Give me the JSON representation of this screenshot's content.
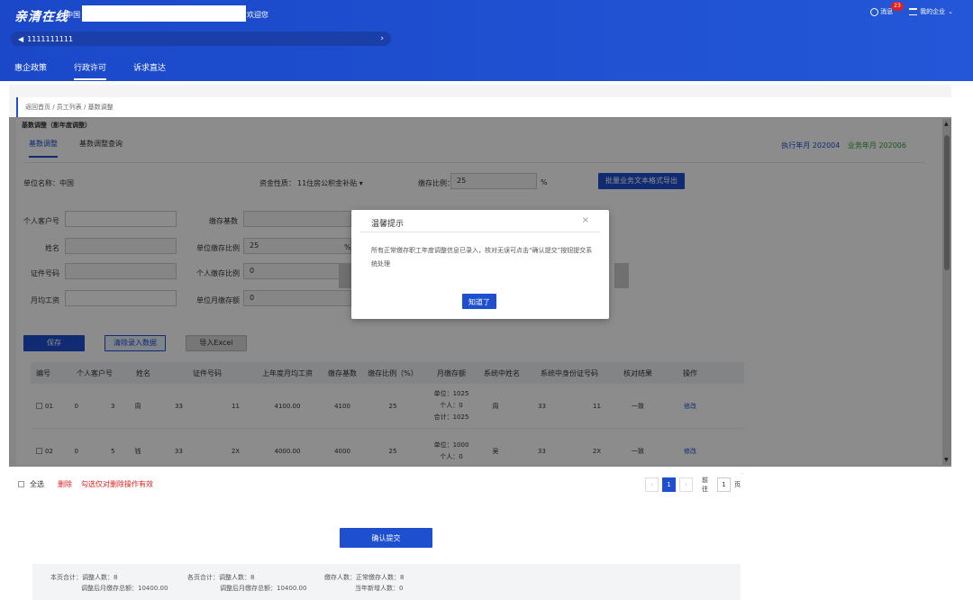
{
  "header": {
    "logo": "亲清在线",
    "region": "· 中国",
    "welcome": "欢迎您",
    "messages_label": "消息",
    "messages_count": "23",
    "enterprise_label": "我的企业",
    "notice_text": "1111111111",
    "nav": [
      {
        "label": "惠企政策"
      },
      {
        "label": "行政许可"
      },
      {
        "label": "诉求直达"
      }
    ]
  },
  "breadcrumb": "返回首页 / 员工列表 / 基数调整",
  "panel": {
    "title": "基数调整（影年度调整）",
    "tabs": [
      {
        "label": "基数调整"
      },
      {
        "label": "基数调整查询"
      }
    ],
    "exec_year": "执行年月 202004",
    "biz_year": "业务年月 202006"
  },
  "form": {
    "unit_name_label": "单位名称：中国",
    "fund_type_label": "资金性质：",
    "fund_type_value": "11住房公积金补贴",
    "ratio_label": "缴存比例：",
    "ratio_value": "25",
    "ratio_unit": "%",
    "export_button": "批量业务文本格式导出",
    "personal_account_label": "个人客户号",
    "deposit_base_label": "缴存基数",
    "name_label": "姓名",
    "unit_ratio_label": "单位缴存比例",
    "unit_ratio_value": "25",
    "id_label": "证件号码",
    "personal_ratio_label": "个人缴存比例",
    "personal_ratio_value": "0",
    "monthly_wage_label": "月均工资",
    "unit_monthly_label": "单位月缴存额",
    "unit_monthly_value": "0",
    "percent": "%"
  },
  "buttons": {
    "save": "保存",
    "clear": "清除录入数据",
    "import": "导入Excel"
  },
  "table": {
    "headers": [
      "编号",
      "个人客户号",
      "姓名",
      "证件号码",
      "上年度月均工资",
      "缴存基数",
      "缴存比例（%）",
      "月缴存额",
      "系统中姓名",
      "系统中身份证号码",
      "核对结果",
      "操作"
    ],
    "rows": [
      {
        "no": "01",
        "acct_start": "0",
        "acct_end": "3",
        "name_start": "周",
        "id_start": "33",
        "id_end": "11",
        "wage": "4100.00",
        "base": "4100",
        "ratio": "25",
        "monthly": [
          "单位：1025",
          "个人：0",
          "合计：1025"
        ],
        "sys_name": "周",
        "sys_id_start": "33",
        "sys_id_end": "11",
        "result": "一致",
        "action": "修改"
      },
      {
        "no": "02",
        "acct_start": "0",
        "acct_end": "5",
        "name_start": "钱",
        "id_start": "33",
        "id_end": "2X",
        "wage": "4000.00",
        "base": "4000",
        "ratio": "25",
        "monthly": [
          "单位：1000",
          "个人：0"
        ],
        "sys_name": "吴",
        "sys_id_start": "33",
        "sys_id_end": "2X",
        "result": "一致",
        "action": "修改"
      }
    ]
  },
  "dialog": {
    "title": "温馨提示",
    "close": "×",
    "body": "所有正常缴存职工年度调整信息已录入，核对无误可点击“确认提交”按钮提交系统处理",
    "ok": "知道了"
  },
  "footer": {
    "select_all": "全选",
    "delete": "删除",
    "hint": "勾选仅对删除操作有效",
    "prev": "‹",
    "page": "1",
    "next": "›",
    "goto_label": "前往",
    "goto_value": "1",
    "page_unit": "页",
    "confirm": "确认提交"
  },
  "summary": {
    "page_total": "本页合计：调整人数：8",
    "page_amount": "调整后月缴存总额：10400.00",
    "all_total": "各页合计：调整人数：8",
    "all_amount": "调整后月缴存总额：10400.00",
    "deposit_count": "缴存人数：正常缴存人数：8",
    "new_count": "当年新增人数：0"
  }
}
